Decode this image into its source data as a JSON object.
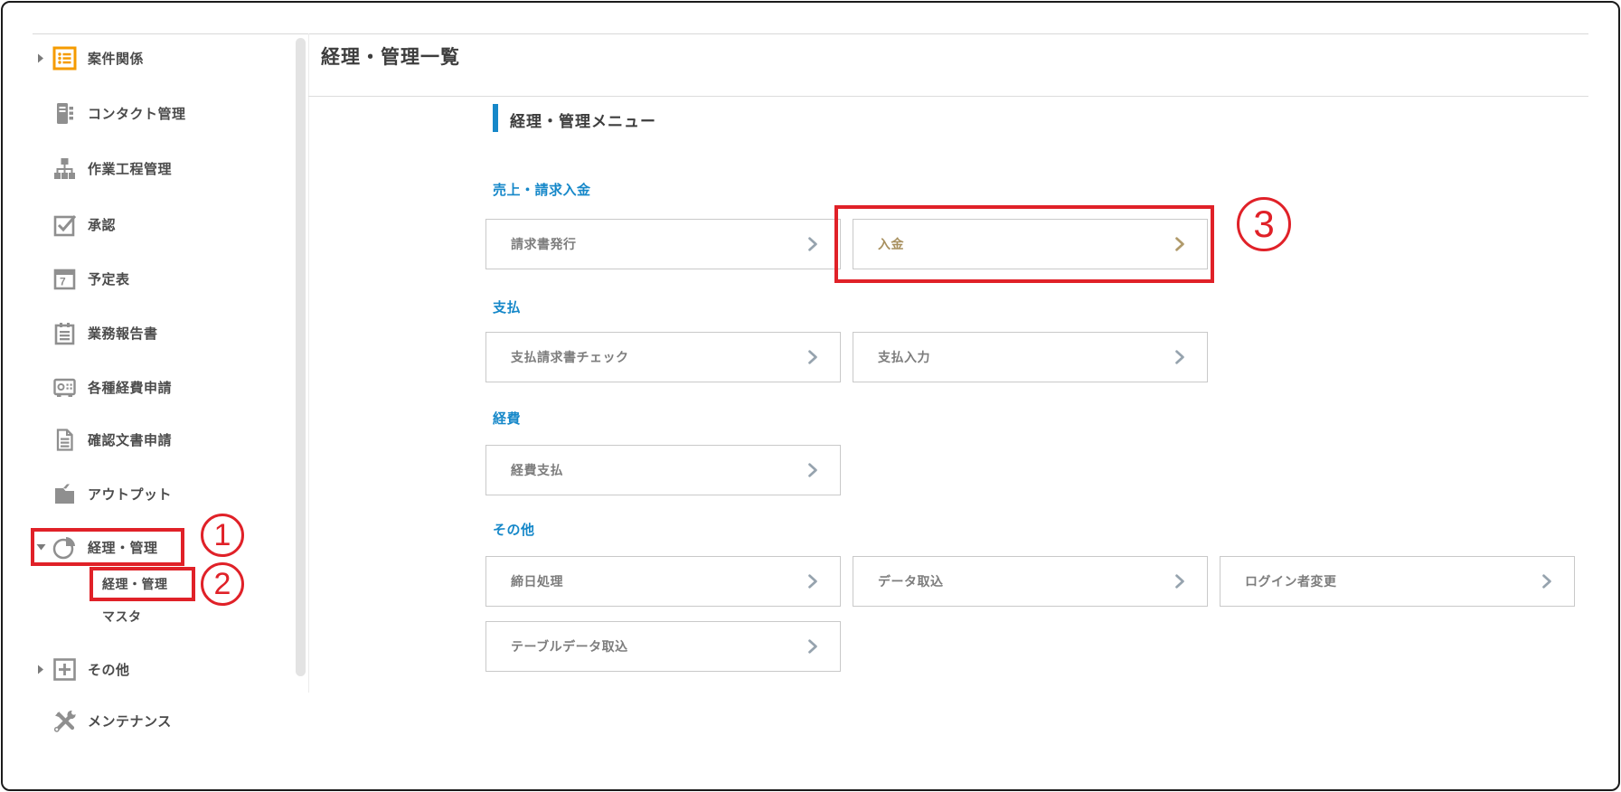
{
  "colors": {
    "accent_blue": "#1688c9",
    "annotation_red": "#e02128",
    "icon_orange": "#f59b00",
    "icon_gray": "#8f8f8f",
    "highlight_gold": "#a8905f"
  },
  "sidebar": {
    "items": [
      {
        "label": "案件関係",
        "icon": "list-icon",
        "expander": "right"
      },
      {
        "label": "コンタクト管理",
        "icon": "contact-icon",
        "expander": ""
      },
      {
        "label": "作業工程管理",
        "icon": "sitemap-icon",
        "expander": ""
      },
      {
        "label": "承認",
        "icon": "checkbox-icon",
        "expander": ""
      },
      {
        "label": "予定表",
        "icon": "calendar-icon",
        "expander": "",
        "calendar_digit": "7"
      },
      {
        "label": "業務報告書",
        "icon": "clipboard-icon",
        "expander": ""
      },
      {
        "label": "各種経費申請",
        "icon": "cash-register-icon",
        "expander": ""
      },
      {
        "label": "確認文書申請",
        "icon": "document-icon",
        "expander": ""
      },
      {
        "label": "アウトプット",
        "icon": "folder-icon",
        "expander": ""
      },
      {
        "label": "経理・管理",
        "icon": "pie-chart-icon",
        "expander": "down"
      },
      {
        "label": "その他",
        "icon": "plus-icon",
        "expander": "right"
      },
      {
        "label": "メンテナンス",
        "icon": "wrench-icon",
        "expander": ""
      }
    ],
    "submenu": [
      {
        "label": "経理・管理"
      },
      {
        "label": "マスタ"
      }
    ]
  },
  "main": {
    "page_title": "経理・管理一覧",
    "section_title": "経理・管理メニュー",
    "groups": [
      {
        "heading": "売上・請求入金",
        "buttons": [
          {
            "label": "請求書発行"
          },
          {
            "label": "入金",
            "highlighted": true
          }
        ]
      },
      {
        "heading": "支払",
        "buttons": [
          {
            "label": "支払請求書チェック"
          },
          {
            "label": "支払入力"
          }
        ]
      },
      {
        "heading": "経費",
        "buttons": [
          {
            "label": "経費支払"
          }
        ]
      },
      {
        "heading": "その他",
        "buttons": [
          {
            "label": "締日処理"
          },
          {
            "label": "データ取込"
          },
          {
            "label": "ログイン者変更"
          },
          {
            "label": "テーブルデータ取込"
          }
        ]
      }
    ]
  },
  "annotations": {
    "steps": [
      "1",
      "2",
      "3"
    ]
  }
}
